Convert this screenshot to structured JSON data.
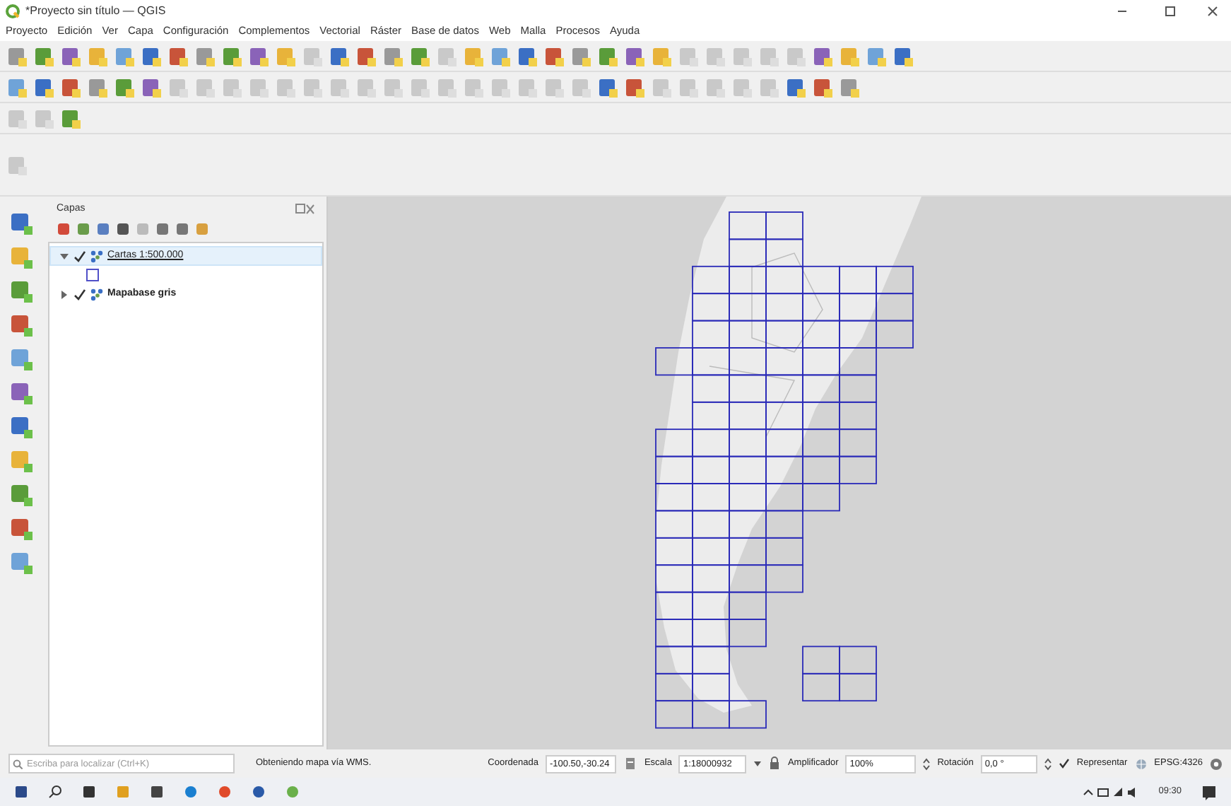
{
  "window": {
    "title": "*Proyecto sin título — QGIS"
  },
  "menu": [
    "Proyecto",
    "Edición",
    "Ver",
    "Capa",
    "Configuración",
    "Complementos",
    "Vectorial",
    "Ráster",
    "Base de datos",
    "Web",
    "Malla",
    "Procesos",
    "Ayuda"
  ],
  "layers_panel": {
    "title": "Capas",
    "layers": [
      {
        "name": "Cartas 1:500.000",
        "checked": true,
        "expanded": true,
        "selected": true
      },
      {
        "name": "Mapabase gris",
        "checked": true,
        "expanded": false,
        "selected": false
      }
    ]
  },
  "status_bar": {
    "search": {
      "placeholder": "Escriba para localizar (Ctrl+K)"
    },
    "message": "Obteniendo mapa vía WMS.",
    "coordinate_label": "Coordenada",
    "coordinate": "-100.50,-30.24",
    "scale_label": "Escala",
    "scale": "1:18000932",
    "magnifier_label": "Amplificador",
    "magnifier": "100%",
    "rotation_label": "Rotación",
    "rotation": "0,0 °",
    "render": {
      "label": "Representar",
      "checked": true
    },
    "crs": "EPSG:4326"
  },
  "taskbar": {
    "time": "09:30"
  }
}
